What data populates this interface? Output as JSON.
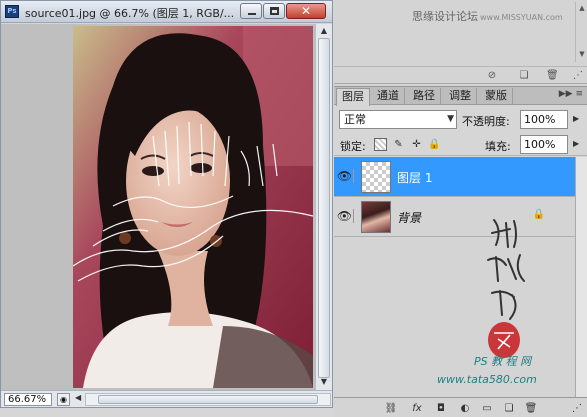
{
  "document": {
    "title": "source01.jpg @ 66.7% (图层 1, RGB/...",
    "zoom": "66.67%"
  },
  "watermark": {
    "text": "思缘设计论坛",
    "url": "www.MISSYUAN.com"
  },
  "layers_panel": {
    "tabs": [
      "图层",
      "通道",
      "路径",
      "调整",
      "蒙版"
    ],
    "active_tab": "图层",
    "blend_mode": "正常",
    "opacity_label": "不透明度:",
    "opacity": "100%",
    "lock_label": "锁定:",
    "fill_label": "填充:",
    "fill": "100%",
    "layers": [
      {
        "name": "图层 1",
        "selected": true,
        "visible": true,
        "thumbnail": "transparent"
      },
      {
        "name": "背景",
        "selected": false,
        "visible": true,
        "thumbnail": "image",
        "locked": true
      }
    ]
  },
  "site_watermark": {
    "line1": "PS 教 程 网",
    "line2": "www.tata580.com"
  },
  "colors": {
    "selection": "#3399ff",
    "title_gradient_top": "#e6ecf3",
    "close_button": "#c2402e"
  }
}
